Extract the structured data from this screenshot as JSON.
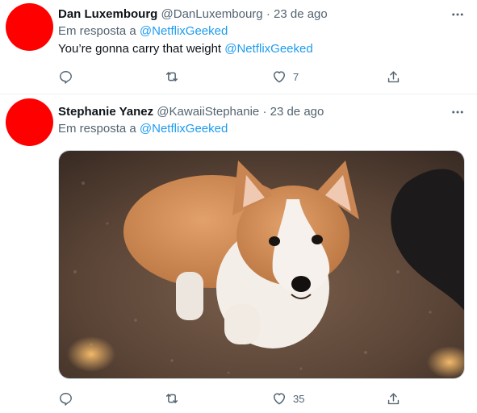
{
  "tweets": [
    {
      "author_name": "Dan Luxembourg",
      "handle": "@DanLuxembourg",
      "separator": "·",
      "date": "23 de ago",
      "reply_prefix": "Em resposta a ",
      "reply_to": "@NetflixGeeked",
      "body_text": "You’re gonna carry that weight ",
      "body_mention": "@NetflixGeeked",
      "like_count": "7",
      "avatar_color": "#ff0000"
    },
    {
      "author_name": "Stephanie Yanez",
      "handle": "@KawaiiStephanie",
      "separator": "·",
      "date": "23 de ago",
      "reply_prefix": "Em resposta a ",
      "reply_to": "@NetflixGeeked",
      "media": "corgi-photo",
      "like_count": "35",
      "avatar_color": "#ff0000"
    }
  ],
  "icons": {
    "more": "more-dots-icon",
    "reply": "reply-bubble-icon",
    "retweet": "retweet-icon",
    "like": "heart-icon",
    "share": "share-upload-icon"
  },
  "colors": {
    "link": "#1d9bf0",
    "secondary_text": "#536471",
    "primary_text": "#0f1419"
  }
}
